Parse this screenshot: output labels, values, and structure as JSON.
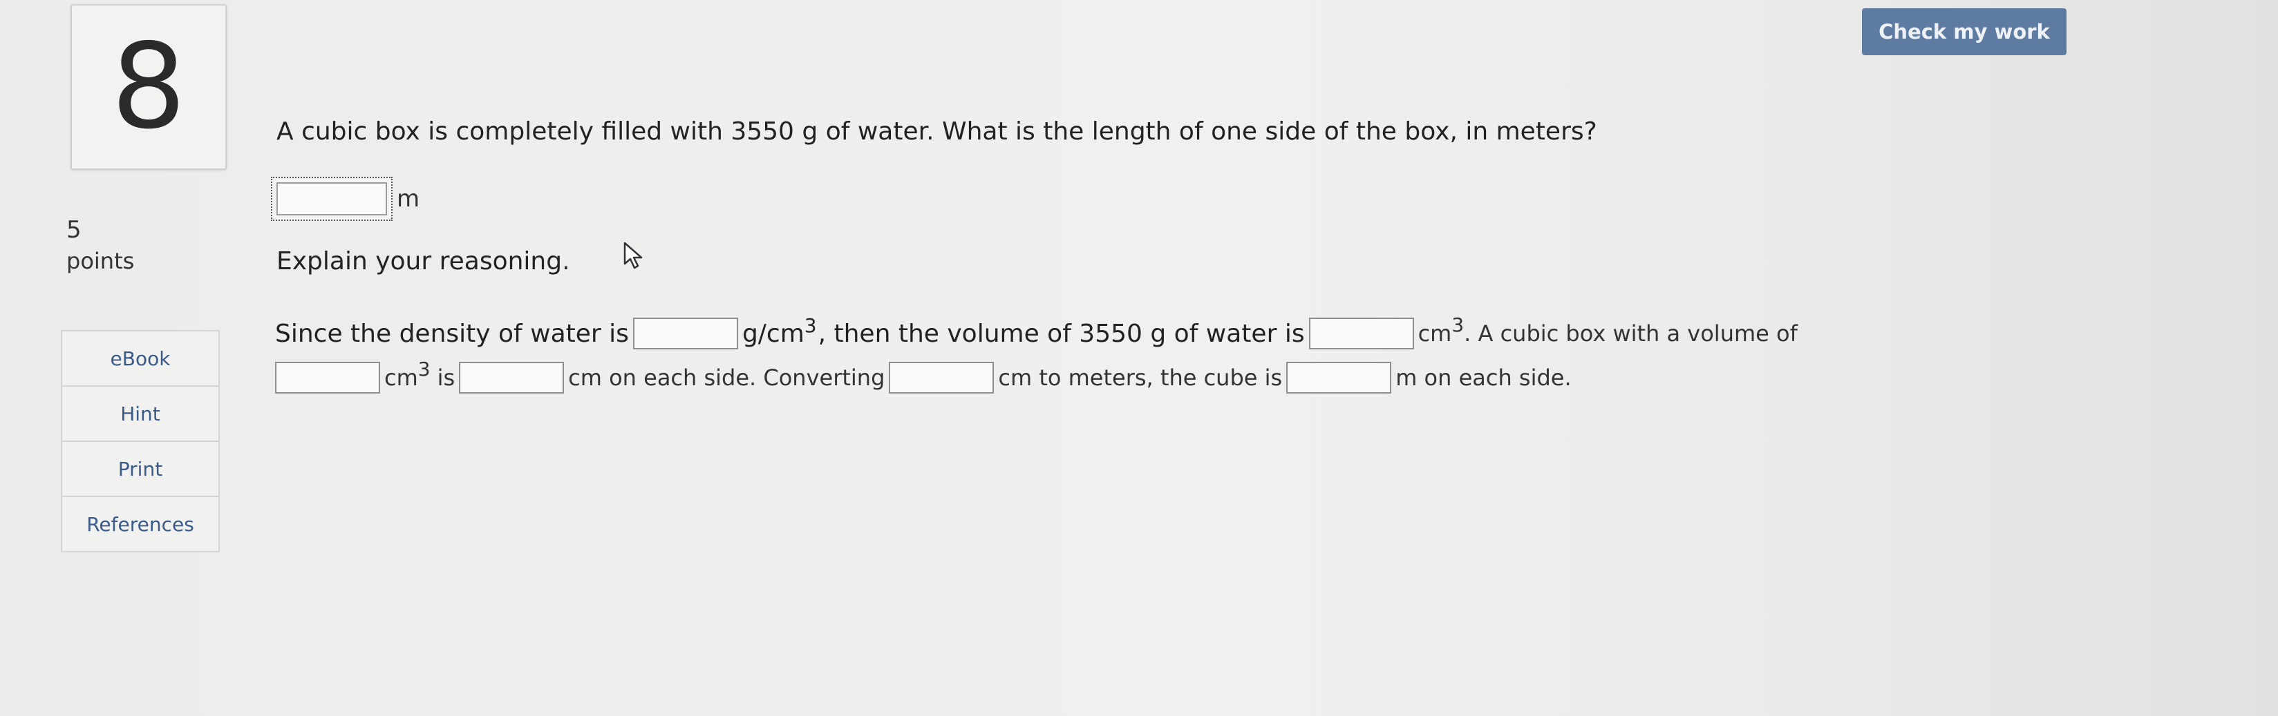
{
  "question_number": "8",
  "points": {
    "value": "5",
    "label": "points"
  },
  "tools": [
    {
      "label": "eBook"
    },
    {
      "label": "Hint"
    },
    {
      "label": "Print"
    },
    {
      "label": "References"
    }
  ],
  "check_button_label": "Check my work",
  "question_text": "A cubic box is completely filled with 3550 g of water. What is the length of one side of the box, in meters?",
  "answer": {
    "value": "",
    "unit": "m"
  },
  "explain_prompt": "Explain your reasoning.",
  "reasoning": {
    "t1": "Since the density of water is",
    "t2": "g/cm",
    "t2_exp": "3",
    "t3": ", then the volume of 3550 g of water is",
    "t4": "cm",
    "t4_exp": "3",
    "t5": ". A cubic box with a volume of",
    "t6": "cm",
    "t6_exp": "3",
    "t7": "is",
    "t8": "cm on each side. Converting",
    "t9": "cm to meters, the cube is",
    "t10": "m on each side."
  },
  "icons": {
    "cursor": "mouse-pointer-icon"
  }
}
